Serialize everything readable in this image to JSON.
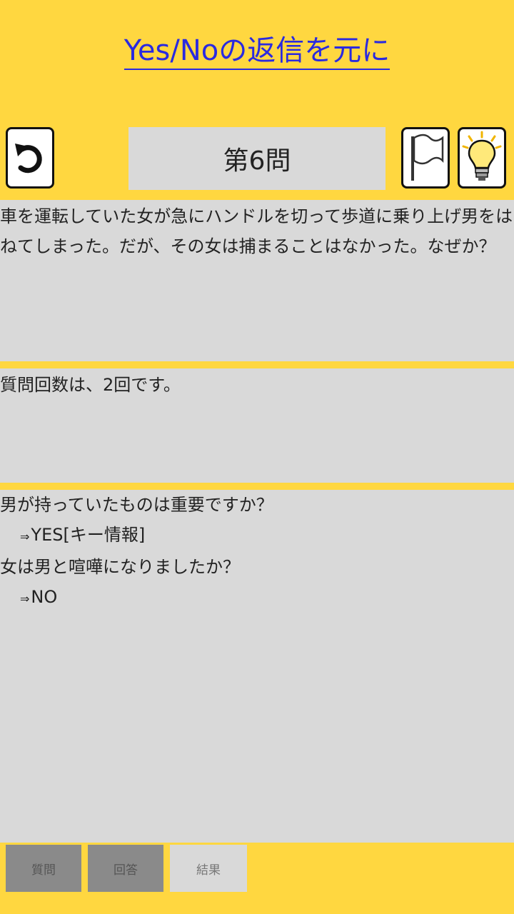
{
  "header": {
    "title_link": "Yes/Noの返信を元に"
  },
  "toolbar": {
    "back_icon": "undo-arrow-icon",
    "question_number": "第6問",
    "flag_icon": "white-flag-icon",
    "hint_icon": "lightbulb-icon"
  },
  "problem": {
    "text": "車を運転していた女が急にハンドルを切って歩道に乗り上げ男をはねてしまった。だが、その女は捕まることはなかった。なぜか？"
  },
  "status": {
    "question_count_text": "質問回数は、2回です。"
  },
  "log": {
    "entries": [
      {
        "question": "男が持っていたものは重要ですか？",
        "arrow": "⇒",
        "answer": "YES[キー情報]"
      },
      {
        "question": "女は男と喧嘩になりましたか？",
        "arrow": "⇒",
        "answer": "NO"
      }
    ]
  },
  "tabs": {
    "question": "質問",
    "answer": "回答",
    "result": "結果"
  },
  "colors": {
    "background": "#FFD740",
    "panel": "#D9D9D9",
    "link": "#2A2AE0",
    "tab_inactive": "#8A8A8A"
  }
}
